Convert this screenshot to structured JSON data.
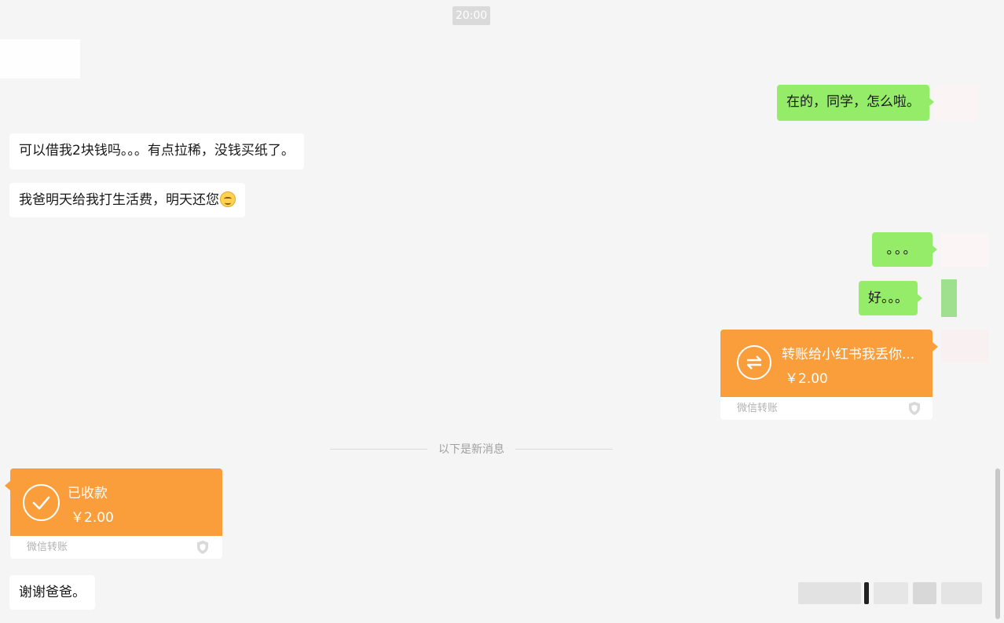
{
  "timestamp": "20:00",
  "messages": {
    "m1": "在的，同学，怎么啦。",
    "m2": "可以借我2块钱吗。。。有点拉稀，没钱买纸了。",
    "m3": "我爸明天给我打生活费，明天还您",
    "m4": "。。。",
    "m5": "好。。。",
    "m6": "谢谢爸爸。"
  },
  "transfer_out": {
    "title": "转账给小红书我丢你...",
    "amount": "￥2.00",
    "footer": "微信转账"
  },
  "new_messages_divider": "以下是新消息",
  "transfer_in": {
    "title": "已收款",
    "amount": "￥2.00",
    "footer": "微信转账"
  },
  "colors": {
    "sent_bubble": "#95ec69",
    "received_bubble": "#ffffff",
    "transfer_orange": "#fa9d3b",
    "background": "#f5f5f5"
  },
  "icons": {
    "emoji": "smile-emoji-icon",
    "transfer_out": "transfer-arrows-icon",
    "transfer_in": "check-circle-icon",
    "shield": "shield-icon"
  }
}
